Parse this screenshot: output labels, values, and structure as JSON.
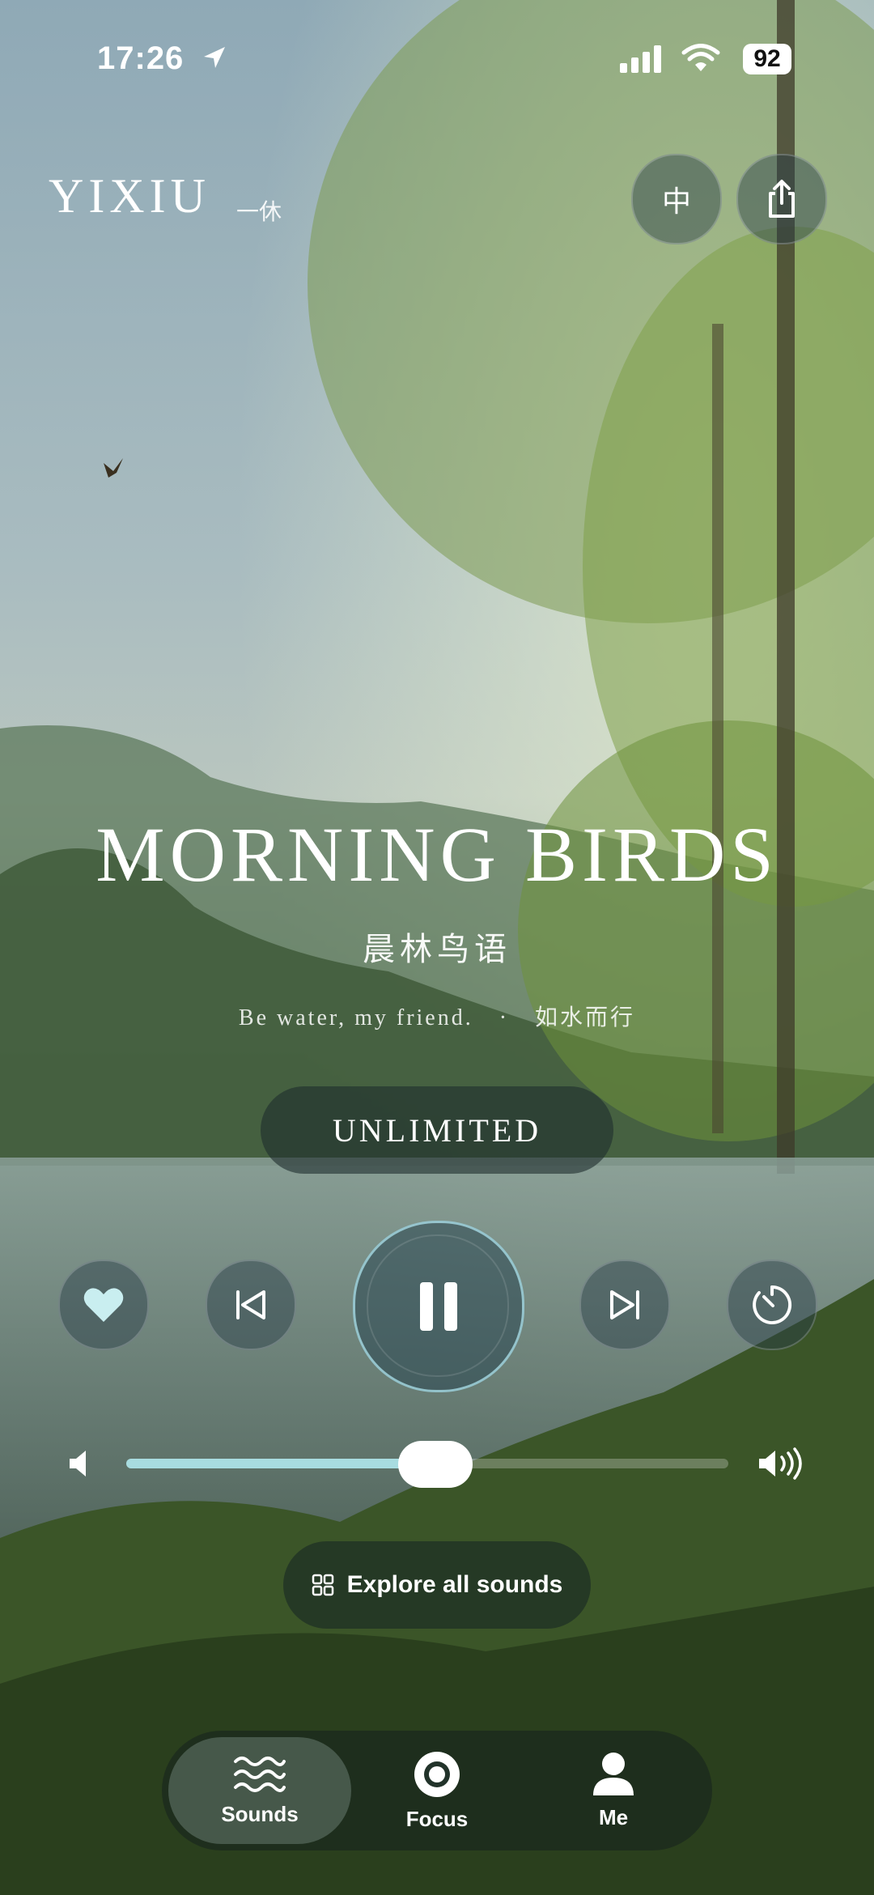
{
  "status_bar": {
    "time": "17:26",
    "battery": "92"
  },
  "header": {
    "brand": "YIXIU",
    "brand_sub": "一休",
    "language_button": "中"
  },
  "track": {
    "title": "MORNING BIRDS",
    "subtitle": "晨林鸟语",
    "quote_en": "Be water, my friend.",
    "quote_sep": "·",
    "quote_cn": "如水而行",
    "duration_label": "UNLIMITED"
  },
  "player": {
    "volume_level": 0.46,
    "liked": true,
    "state": "playing"
  },
  "explore": {
    "label": "Explore all sounds"
  },
  "tabs": [
    {
      "label": "Sounds",
      "icon": "waves-icon",
      "active": true
    },
    {
      "label": "Focus",
      "icon": "target-icon",
      "active": false
    },
    {
      "label": "Me",
      "icon": "person-icon",
      "active": false
    }
  ],
  "colors": {
    "accent": "#a8dce0"
  }
}
